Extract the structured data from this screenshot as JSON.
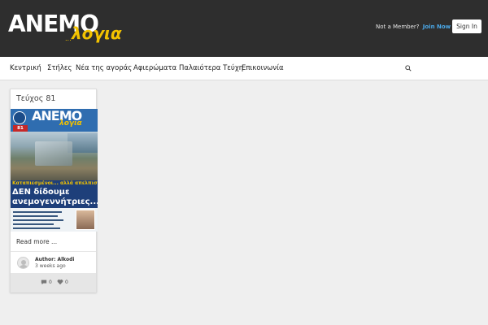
{
  "header": {
    "logo_main": "ΑΝΕΜΟ",
    "logo_sub": "λογια",
    "logo_dots": "...",
    "member_text": "Not a Member?",
    "join_label": "Join Now",
    "signin_label": "Sign In"
  },
  "nav": {
    "items": [
      {
        "label": "Κεντρική"
      },
      {
        "label": "Στήλες"
      },
      {
        "label": "Νέα της αγοράς"
      },
      {
        "label": "Αφιερώματα"
      },
      {
        "label": "Παλαιότερα Τεύχη"
      },
      {
        "label": "Επικοινωνία"
      }
    ],
    "search_icon": "search-icon"
  },
  "card": {
    "title": "Τεύχος 81",
    "cover": {
      "logo_main": "ΑΝΕΜΟ",
      "logo_sub": "λογια",
      "issue_number": "81",
      "headline_small": "Καταπιεσμένοι... αλλά απελπισμένοι",
      "headline_line1": "ΔΕΝ δίδουμε",
      "headline_line2": "ανεμογεννήτριες..."
    },
    "read_more": "Read more ...",
    "author_label": "Author:",
    "author_name": "Alkodi",
    "time_ago": "3 weeks ago",
    "comments_count": "0",
    "likes_count": "0"
  },
  "colors": {
    "header_bg": "#2e2e2e",
    "logo_accent": "#f2c200",
    "join_link": "#4aa8e8",
    "page_bg": "#efefef"
  }
}
